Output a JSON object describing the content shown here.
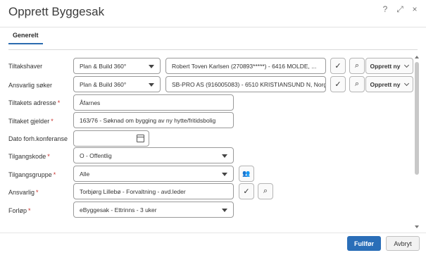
{
  "dialog": {
    "title": "Opprett Byggesak",
    "help": "?",
    "expand": "⤢",
    "close": "×"
  },
  "tabs": [
    {
      "label": "Generelt"
    }
  ],
  "required_marker": "*",
  "fields": {
    "tiltakshaver": {
      "label": "Tiltakshaver",
      "type_value": "Plan & Build 360°",
      "value": "Robert Toven Karlsen (270893*****)  - 6416 MOLDE, ...",
      "create_label": "Opprett ny"
    },
    "ansvarlig_soker": {
      "label": "Ansvarlig søker",
      "type_value": "Plan & Build 360°",
      "value": "SB-PRO AS (916005083)  - 6510 KRISTIANSUND N, Norg...",
      "create_label": "Opprett ny"
    },
    "tiltakets_adresse": {
      "label": "Tiltakets adresse",
      "value": "Åfarnes"
    },
    "tiltaket_gjelder": {
      "label": "Tiltaket gjelder",
      "value": "163/76 - Søknad om bygging av ny hytte/fritidsbolig"
    },
    "dato_forh": {
      "label": "Dato forh.konferanse",
      "value": ""
    },
    "tilgangskode": {
      "label": "Tilgangskode",
      "value": "O - Offentlig"
    },
    "tilgangsgruppe": {
      "label": "Tilgangsgruppe",
      "value": "Alle"
    },
    "ansvarlig": {
      "label": "Ansvarlig",
      "value": "Torbjørg Lillebø - Forvaltning - avd.leder"
    },
    "forlop": {
      "label": "Forløp",
      "value": "eByggesak - Ettrinns - 3 uker"
    }
  },
  "icons": {
    "check": "✓",
    "search": "⌕",
    "group": "👥"
  },
  "footer": {
    "finish_label": "Fullfør",
    "cancel_label": "Avbryt"
  }
}
